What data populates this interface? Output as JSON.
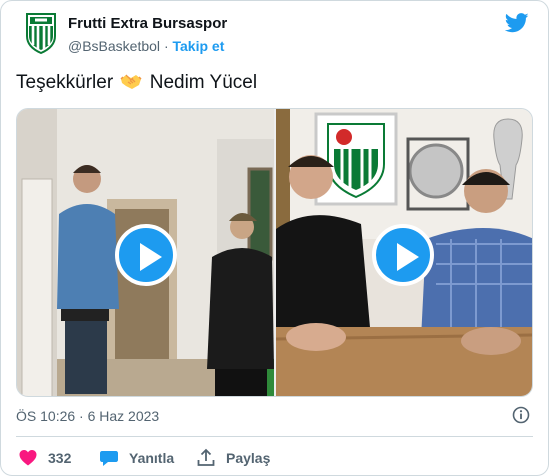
{
  "author": {
    "display_name": "Frutti Extra Bursaspor",
    "handle": "@BsBasketbol",
    "separator": "·",
    "follow_label": "Takip et",
    "avatar_icon": "bursaspor-crest"
  },
  "platform_icon": "twitter-bird-icon",
  "tweet": {
    "text_before": "Teşekkürler",
    "emoji": "handshake-emoji",
    "text_after": "Nedim Yücel"
  },
  "media": {
    "videos": [
      {
        "id": "video-1",
        "play_icon": "play-icon"
      },
      {
        "id": "video-2",
        "play_icon": "play-icon"
      }
    ]
  },
  "meta": {
    "timestamp": "ÖS 10:26 · 6 Haz 2023",
    "info_icon": "info-icon"
  },
  "actions": {
    "like_count": "332",
    "reply_label": "Yanıtla",
    "share_label": "Paylaş"
  },
  "colors": {
    "accent": "#1d9bf0",
    "like": "#f91880",
    "text": "#0f1419",
    "muted": "#536471",
    "border": "#cfd9de"
  }
}
